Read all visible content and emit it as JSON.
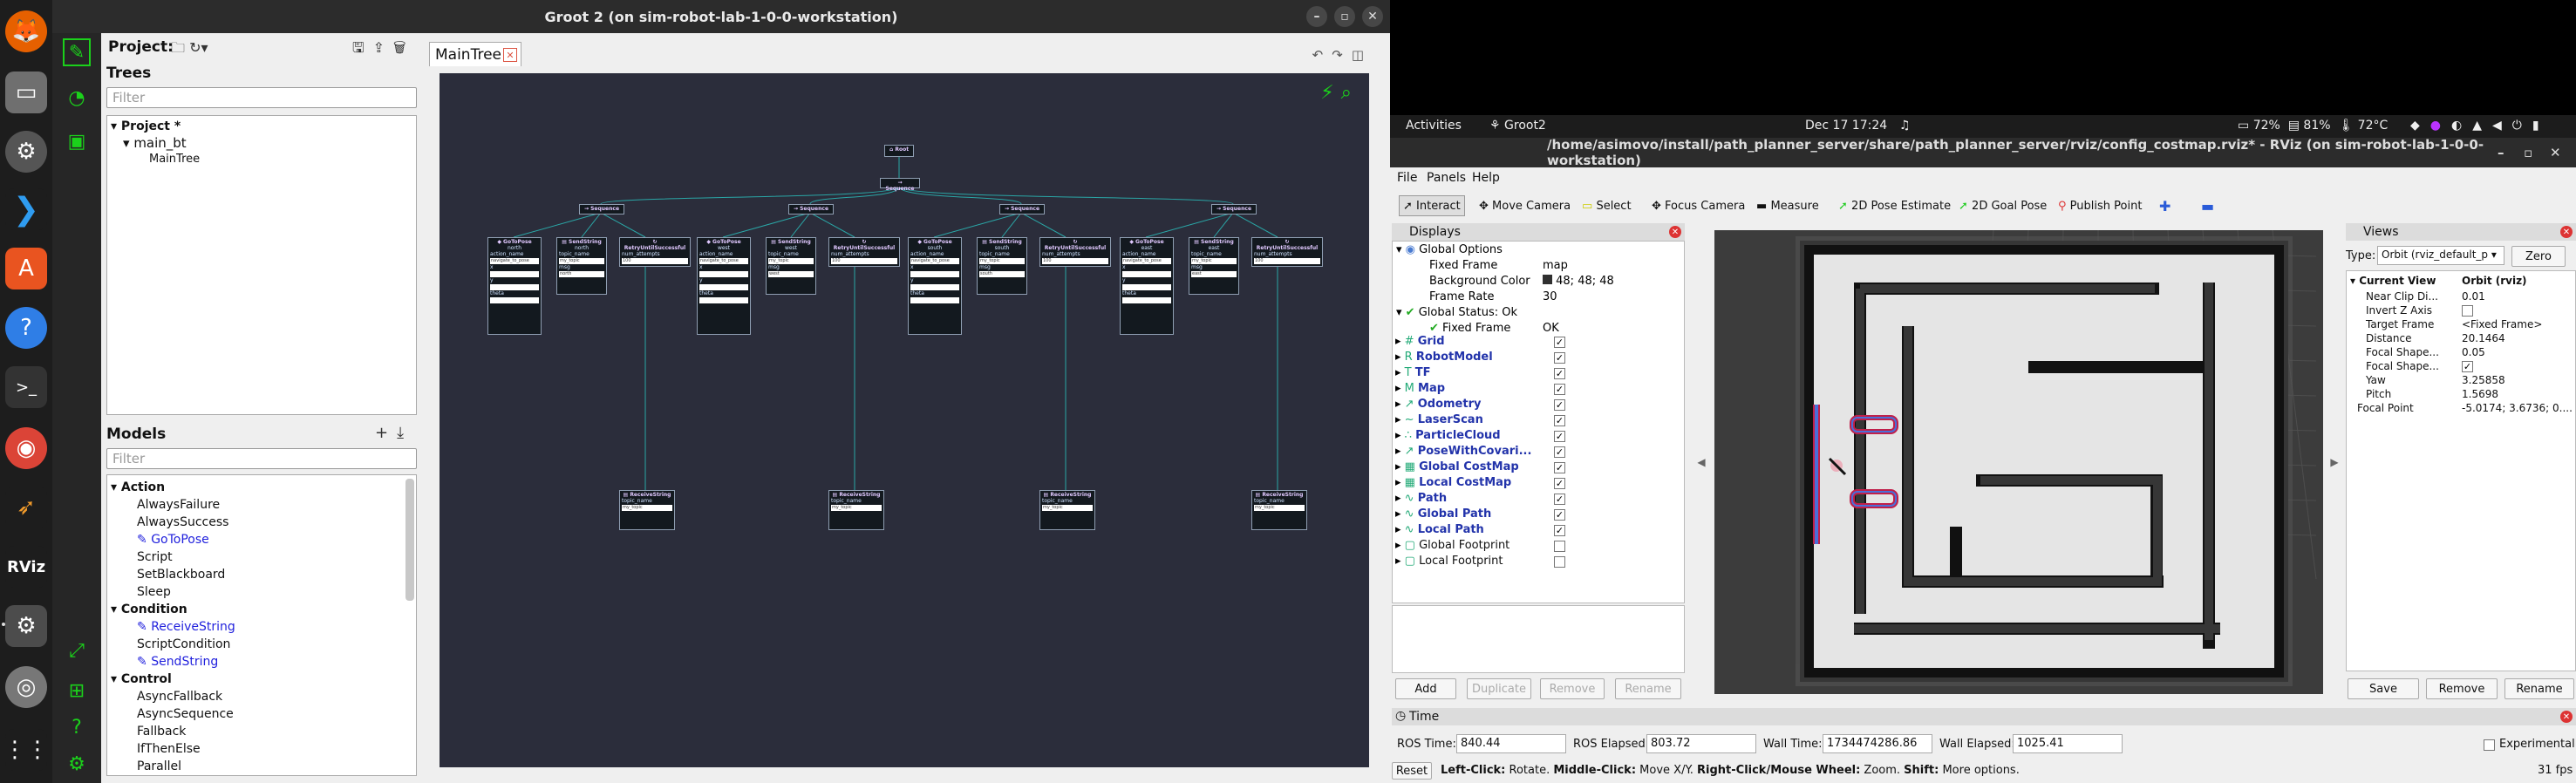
{
  "dock": {
    "icons": [
      "firefox-icon",
      "files-icon",
      "settings-icon",
      "vscode-icon",
      "app-center-icon",
      "help-icon",
      "terminal-icon",
      "chrome-icon",
      "rocket-icon",
      "rviz-icon",
      "settings-gear-icon",
      "disk-icon",
      "apps-grid-icon"
    ],
    "rviz_label": "RViz"
  },
  "groot": {
    "title": "Groot 2 (on sim-robot-lab-1-0-0-workstation)",
    "project_label": "Project:",
    "trees_label": "Trees",
    "filter_placeholder": "Filter",
    "tree": {
      "project": "Project *",
      "main_bt": "main_bt",
      "maintree": "MainTree"
    },
    "models_label": "Models",
    "models": {
      "action_header": "Action",
      "always_failure": "AlwaysFailure",
      "always_success": "AlwaysSuccess",
      "gotopose": "GoToPose",
      "script": "Script",
      "set_blackboard": "SetBlackboard",
      "sleep": "Sleep",
      "condition_header": "Condition",
      "receive_string": "ReceiveString",
      "script_condition": "ScriptCondition",
      "send_string": "SendString",
      "control_header": "Control",
      "async_fallback": "AsyncFallback",
      "async_sequence": "AsyncSequence",
      "fallback": "Fallback",
      "if_then_else": "IfThenElse",
      "parallel": "Parallel"
    },
    "tab": "MainTree",
    "bt": {
      "root": "Root",
      "sequence": "Sequence",
      "gotopose": "GoToPose",
      "sendstring": "SendString",
      "retry": "RetryUntilSuccessful",
      "receive": "ReceiveString",
      "action_name": "action_name",
      "navigate": "navigate_to_pose",
      "topic_name": "topic_name",
      "my_topic": "my_topic",
      "msg": "msg",
      "num_attempts": "num_attempts",
      "attempts_val": "100",
      "x": "x",
      "y": "y",
      "theta": "theta",
      "directions": [
        "north",
        "west",
        "south",
        "east"
      ]
    }
  },
  "system": {
    "activities": "Activities",
    "app": "Groot2",
    "datetime": "Dec 17  17:24",
    "zoom": "72%",
    "battery": "81%",
    "temp": "72°C"
  },
  "rviz": {
    "title": "/home/asimovo/install/path_planner_server/share/path_planner_server/rviz/config_costmap.rviz* - RViz (on sim-robot-lab-1-0-0-workstation)",
    "menu": [
      "File",
      "Panels",
      "Help"
    ],
    "tools": [
      "Interact",
      "Move Camera",
      "Select",
      "Focus Camera",
      "Measure",
      "2D Pose Estimate",
      "2D Goal Pose",
      "Publish Point"
    ],
    "displays_title": "Displays",
    "global_options": "Global Options",
    "fixed_frame_lbl": "Fixed Frame",
    "fixed_frame_val": "map",
    "bg_color_lbl": "Background Color",
    "bg_color_val": "48; 48; 48",
    "frame_rate_lbl": "Frame Rate",
    "frame_rate_val": "30",
    "global_status": "Global Status: Ok",
    "status_fixed_frame": "Fixed Frame",
    "status_ok": "OK",
    "displays": [
      "Grid",
      "RobotModel",
      "TF",
      "Map",
      "Odometry",
      "LaserScan",
      "ParticleCloud",
      "PoseWithCovari...",
      "Global CostMap",
      "Local CostMap",
      "Path",
      "Global Path",
      "Local Path",
      "Global Footprint",
      "Local Footprint"
    ],
    "display_buttons": [
      "Add",
      "Duplicate",
      "Remove",
      "Rename"
    ],
    "views_title": "Views",
    "type_lbl": "Type:",
    "type_val": "Orbit (rviz_default_p",
    "zero": "Zero",
    "current_view": "Current View",
    "current_view_val": "Orbit (rviz)",
    "view_props": [
      [
        "Near Clip Di...",
        "0.01"
      ],
      [
        "Invert Z Axis",
        ""
      ],
      [
        "Target Frame",
        "<Fixed Frame>"
      ],
      [
        "Distance",
        "20.1464"
      ],
      [
        "Focal Shape...",
        "0.05"
      ],
      [
        "Focal Shape...",
        ""
      ],
      [
        "Yaw",
        "3.25858"
      ],
      [
        "Pitch",
        "1.5698"
      ],
      [
        "Focal Point",
        "-5.0174; 3.6736; 0...."
      ]
    ],
    "view_buttons": [
      "Save",
      "Remove",
      "Rename"
    ],
    "time_title": "Time",
    "ros_time_lbl": "ROS Time:",
    "ros_time": "840.44",
    "ros_elapsed_lbl": "ROS Elapsed:",
    "ros_elapsed": "803.72",
    "wall_time_lbl": "Wall Time:",
    "wall_time": "1734474286.86",
    "wall_elapsed_lbl": "Wall Elapsed:",
    "wall_elapsed": "1025.41",
    "experimental": "Experimental",
    "reset": "Reset",
    "hint_left": "Left-Click:",
    "hint_left_t": " Rotate. ",
    "hint_mid": "Middle-Click:",
    "hint_mid_t": " Move X/Y. ",
    "hint_right": "Right-Click/Mouse Wheel:",
    "hint_right_t": " Zoom. ",
    "hint_shift": "Shift:",
    "hint_shift_t": " More options.",
    "fps": "31 fps"
  },
  "colors": {
    "groot_green": "#1bd11b",
    "canvas_bg": "#2b2d3b",
    "edge": "#2aa6a6",
    "display_link": "#2233aa",
    "path_blue": "#4a6fd8",
    "path_red": "#c0204a"
  }
}
